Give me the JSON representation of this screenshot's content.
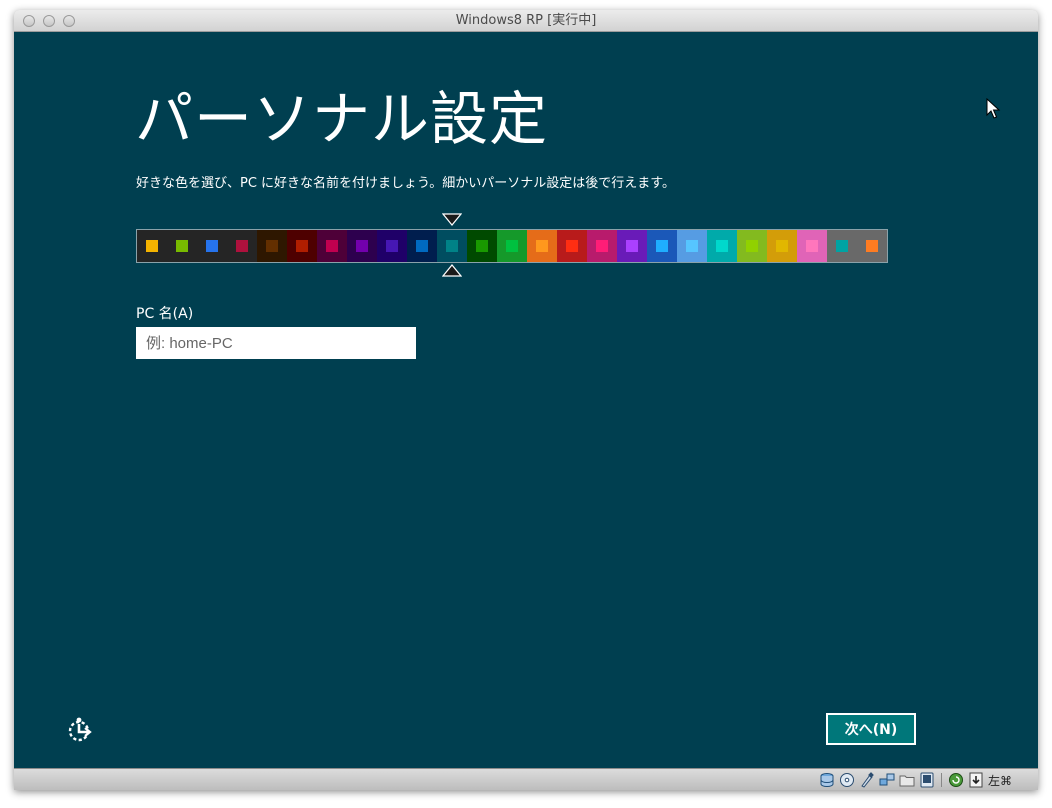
{
  "window": {
    "title": "Windows8 RP [実行中]"
  },
  "setup": {
    "heading": "パーソナル設定",
    "subtitle": "好きな色を選び、PC に好きな名前を付けましょう。細かいパーソナル設定は後で行えます。",
    "selected_color_index": 10,
    "palette": [
      {
        "bg": "#252525",
        "fg": "#f4b300"
      },
      {
        "bg": "#252525",
        "fg": "#78ba00"
      },
      {
        "bg": "#252525",
        "fg": "#2673ec"
      },
      {
        "bg": "#252525",
        "fg": "#ae113d"
      },
      {
        "bg": "#2e1700",
        "fg": "#632f00"
      },
      {
        "bg": "#4e0000",
        "fg": "#b01e00"
      },
      {
        "bg": "#4e0038",
        "fg": "#c1004f"
      },
      {
        "bg": "#2d004e",
        "fg": "#7200ac"
      },
      {
        "bg": "#1f0068",
        "fg": "#4617b4"
      },
      {
        "bg": "#001e4e",
        "fg": "#006ac1"
      },
      {
        "bg": "#004d60",
        "fg": "#008287"
      },
      {
        "bg": "#004a00",
        "fg": "#199900"
      },
      {
        "bg": "#15992a",
        "fg": "#00c13f"
      },
      {
        "bg": "#e56c19",
        "fg": "#ff981d"
      },
      {
        "bg": "#b81b1b",
        "fg": "#ff2e12"
      },
      {
        "bg": "#b81b6c",
        "fg": "#ff1d77"
      },
      {
        "bg": "#691bb8",
        "fg": "#aa40ff"
      },
      {
        "bg": "#1b58b8",
        "fg": "#1faeff"
      },
      {
        "bg": "#569ce3",
        "fg": "#56c5ff"
      },
      {
        "bg": "#00aaaa",
        "fg": "#00d8cc"
      },
      {
        "bg": "#83ba1f",
        "fg": "#91d100"
      },
      {
        "bg": "#d39d09",
        "fg": "#e1b700"
      },
      {
        "bg": "#e064b7",
        "fg": "#ff76bc"
      },
      {
        "bg": "#696969",
        "fg": "#00a3a3"
      },
      {
        "bg": "#696969",
        "fg": "#fe7c22"
      }
    ],
    "pc_name_label": "PC 名(A)",
    "pc_name_placeholder": "例: home-PC",
    "pc_name_value": "",
    "next_label": "次へ(N)"
  },
  "statusbar": {
    "icons": [
      "hard-disk-icon",
      "optical-disc-icon",
      "usb-icon",
      "network-icon",
      "shared-folder-icon",
      "display-icon",
      "video-capture-icon",
      "mouse-integration-icon"
    ],
    "host_key": "左⌘"
  }
}
